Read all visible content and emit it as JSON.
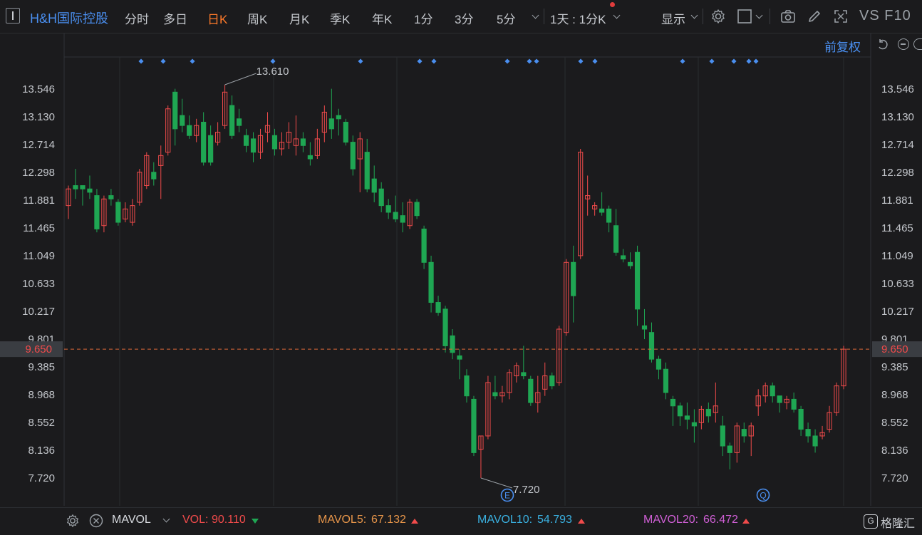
{
  "header": {
    "stock_name": "H&H国际控股",
    "periods": [
      "分时",
      "多日",
      "日K",
      "周K",
      "月K",
      "季K",
      "年K",
      "1分",
      "3分",
      "5分"
    ],
    "active_period": "日K",
    "interval": "1天 : 1分K",
    "display_label": "显示",
    "vs_label": "VS",
    "f10_label": "F10",
    "adjust_label": "前复权"
  },
  "colors": {
    "up": "#f14b4b",
    "down": "#1fa653",
    "accent": "#4a8ff0",
    "active_tab": "#ff7a2a",
    "price_line": "#e06a3a"
  },
  "price_axis": {
    "ticks": [
      "13.546",
      "13.130",
      "12.714",
      "12.298",
      "11.881",
      "11.465",
      "11.049",
      "10.633",
      "10.217",
      "9.801",
      "9.385",
      "8.968",
      "8.552",
      "8.136",
      "7.720"
    ],
    "current_price": "9.650",
    "high_label": "13.610",
    "low_label": "7.720"
  },
  "event_markers": [
    "E",
    "Q"
  ],
  "volume_bar": {
    "indicator": "MAVOL",
    "vol_label": "VOL:",
    "vol_value": "90.110",
    "mavol5_label": "MAVOL5:",
    "mavol5_value": "67.132",
    "mavol10_label": "MAVOL10:",
    "mavol10_value": "54.793",
    "mavol20_label": "MAVOL20:",
    "mavol20_value": "66.472",
    "mavol5_color": "#e8964a",
    "mavol10_color": "#3ab0e0",
    "mavol20_color": "#d05fd6",
    "brand": "格隆汇"
  },
  "chart_data": {
    "type": "candlestick",
    "ylim": [
      7.5,
      13.85
    ],
    "ohlc": [
      [
        11.8,
        12.1,
        11.6,
        12.05
      ],
      [
        12.1,
        12.35,
        11.9,
        12.05
      ],
      [
        12.1,
        12.1,
        11.8,
        12.05
      ],
      [
        12.05,
        12.25,
        11.9,
        12.0
      ],
      [
        11.95,
        12.05,
        11.4,
        11.45
      ],
      [
        11.5,
        11.95,
        11.4,
        11.9
      ],
      [
        11.95,
        12.05,
        11.8,
        11.9
      ],
      [
        11.85,
        11.9,
        11.5,
        11.55
      ],
      [
        11.6,
        11.85,
        11.55,
        11.75
      ],
      [
        11.55,
        11.9,
        11.5,
        11.8
      ],
      [
        11.85,
        12.35,
        11.8,
        12.3
      ],
      [
        12.1,
        12.6,
        12.05,
        12.55
      ],
      [
        12.3,
        12.45,
        12.1,
        12.2
      ],
      [
        12.4,
        12.7,
        11.9,
        12.55
      ],
      [
        12.6,
        13.3,
        12.55,
        13.25
      ],
      [
        13.5,
        13.55,
        12.7,
        12.95
      ],
      [
        13.15,
        13.4,
        12.9,
        13.0
      ],
      [
        13.0,
        13.15,
        12.8,
        12.85
      ],
      [
        12.85,
        13.1,
        12.75,
        13.0
      ],
      [
        13.05,
        13.2,
        12.4,
        12.45
      ],
      [
        12.85,
        13.0,
        12.4,
        12.45
      ],
      [
        12.75,
        13.05,
        12.7,
        12.9
      ],
      [
        13.0,
        13.61,
        12.95,
        13.5
      ],
      [
        13.3,
        13.45,
        12.8,
        12.85
      ],
      [
        13.1,
        13.25,
        12.9,
        13.0
      ],
      [
        12.85,
        12.95,
        12.6,
        12.7
      ],
      [
        12.8,
        12.9,
        12.45,
        12.6
      ],
      [
        12.6,
        12.95,
        12.5,
        12.85
      ],
      [
        12.9,
        13.2,
        12.75,
        13.0
      ],
      [
        12.85,
        12.95,
        12.55,
        12.65
      ],
      [
        12.65,
        12.9,
        12.55,
        12.75
      ],
      [
        12.75,
        13.05,
        12.65,
        12.9
      ],
      [
        12.7,
        13.15,
        12.55,
        12.8
      ],
      [
        12.8,
        12.9,
        12.6,
        12.7
      ],
      [
        12.55,
        12.75,
        12.4,
        12.5
      ],
      [
        12.55,
        12.95,
        12.5,
        12.8
      ],
      [
        12.9,
        13.3,
        12.75,
        13.2
      ],
      [
        13.1,
        13.55,
        12.8,
        12.95
      ],
      [
        13.15,
        13.25,
        12.85,
        13.1
      ],
      [
        13.05,
        13.1,
        12.7,
        12.75
      ],
      [
        12.75,
        12.85,
        12.25,
        12.35
      ],
      [
        12.5,
        12.9,
        12.0,
        12.8
      ],
      [
        12.6,
        12.8,
        12.0,
        12.05
      ],
      [
        12.2,
        12.4,
        11.85,
        12.0
      ],
      [
        12.05,
        12.15,
        11.7,
        11.8
      ],
      [
        11.8,
        11.9,
        11.6,
        11.7
      ],
      [
        11.7,
        11.95,
        11.55,
        11.6
      ],
      [
        11.65,
        11.85,
        11.4,
        11.55
      ],
      [
        11.5,
        11.9,
        11.45,
        11.85
      ],
      [
        11.85,
        11.9,
        11.6,
        11.65
      ],
      [
        11.45,
        11.5,
        10.85,
        10.95
      ],
      [
        10.95,
        11.05,
        10.2,
        10.35
      ],
      [
        10.35,
        10.45,
        10.15,
        10.2
      ],
      [
        10.25,
        10.3,
        9.6,
        9.7
      ],
      [
        9.85,
        9.95,
        9.5,
        9.6
      ],
      [
        9.55,
        9.65,
        9.2,
        9.5
      ],
      [
        9.25,
        9.35,
        8.85,
        8.95
      ],
      [
        8.9,
        8.95,
        8.05,
        8.1
      ],
      [
        8.15,
        8.35,
        7.72,
        8.35
      ],
      [
        8.35,
        9.25,
        8.3,
        9.15
      ],
      [
        9.0,
        9.25,
        8.9,
        8.95
      ],
      [
        8.95,
        9.1,
        8.85,
        9.0
      ],
      [
        9.0,
        9.35,
        8.9,
        9.3
      ],
      [
        9.25,
        9.45,
        9.15,
        9.4
      ],
      [
        9.3,
        9.7,
        9.2,
        9.25
      ],
      [
        9.2,
        9.25,
        8.8,
        8.85
      ],
      [
        8.85,
        9.25,
        8.7,
        9.0
      ],
      [
        9.05,
        9.45,
        8.95,
        9.25
      ],
      [
        9.25,
        9.3,
        9.05,
        9.1
      ],
      [
        9.15,
        10.0,
        9.1,
        9.95
      ],
      [
        9.9,
        11.0,
        9.85,
        10.95
      ],
      [
        10.95,
        11.2,
        10.05,
        10.45
      ],
      [
        11.05,
        12.65,
        11.0,
        12.6
      ],
      [
        11.9,
        12.25,
        11.65,
        11.95
      ],
      [
        11.75,
        11.85,
        11.65,
        11.8
      ],
      [
        11.75,
        12.0,
        11.65,
        11.7
      ],
      [
        11.75,
        11.8,
        11.4,
        11.55
      ],
      [
        11.5,
        11.75,
        11.05,
        11.1
      ],
      [
        11.05,
        11.15,
        10.95,
        11.0
      ],
      [
        10.95,
        11.1,
        10.85,
        10.9
      ],
      [
        11.1,
        11.2,
        10.0,
        10.25
      ],
      [
        10.0,
        10.25,
        9.8,
        9.95
      ],
      [
        9.9,
        10.05,
        9.45,
        9.5
      ],
      [
        9.5,
        9.55,
        9.2,
        9.35
      ],
      [
        9.35,
        9.45,
        8.9,
        9.0
      ],
      [
        8.9,
        8.95,
        8.5,
        8.8
      ],
      [
        8.8,
        8.85,
        8.5,
        8.65
      ],
      [
        8.65,
        8.85,
        8.45,
        8.6
      ],
      [
        8.55,
        8.75,
        8.25,
        8.5
      ],
      [
        8.55,
        8.8,
        8.45,
        8.75
      ],
      [
        8.75,
        8.85,
        8.55,
        8.65
      ],
      [
        8.7,
        9.15,
        8.55,
        8.8
      ],
      [
        8.5,
        8.65,
        8.05,
        8.2
      ],
      [
        8.2,
        8.25,
        7.85,
        8.1
      ],
      [
        8.1,
        8.55,
        7.95,
        8.5
      ],
      [
        8.45,
        8.55,
        8.25,
        8.35
      ],
      [
        8.35,
        8.55,
        8.05,
        8.5
      ],
      [
        8.8,
        9.05,
        8.65,
        8.95
      ],
      [
        8.95,
        9.15,
        8.85,
        9.1
      ],
      [
        9.1,
        9.15,
        8.85,
        8.95
      ],
      [
        8.95,
        8.95,
        8.7,
        8.85
      ],
      [
        8.85,
        8.95,
        8.75,
        8.9
      ],
      [
        8.9,
        9.0,
        8.7,
        8.75
      ],
      [
        8.75,
        8.8,
        8.35,
        8.45
      ],
      [
        8.45,
        8.55,
        8.25,
        8.35
      ],
      [
        8.35,
        8.45,
        8.1,
        8.2
      ],
      [
        8.35,
        8.5,
        8.3,
        8.4
      ],
      [
        8.45,
        8.8,
        8.4,
        8.7
      ],
      [
        8.7,
        9.15,
        8.65,
        9.1
      ],
      [
        9.1,
        9.7,
        9.05,
        9.65
      ]
    ]
  }
}
